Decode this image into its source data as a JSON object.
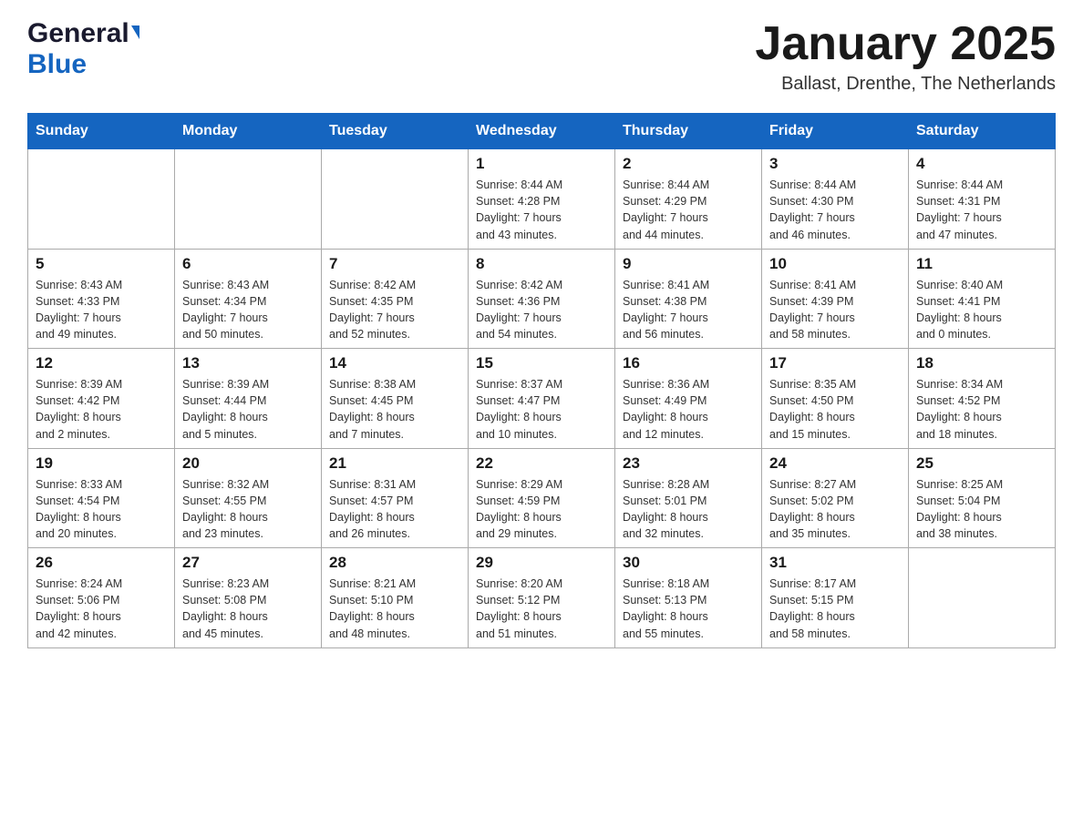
{
  "header": {
    "logo_general": "General",
    "logo_blue": "Blue",
    "month_title": "January 2025",
    "location": "Ballast, Drenthe, The Netherlands"
  },
  "days_of_week": [
    "Sunday",
    "Monday",
    "Tuesday",
    "Wednesday",
    "Thursday",
    "Friday",
    "Saturday"
  ],
  "weeks": [
    [
      {
        "day": "",
        "info": ""
      },
      {
        "day": "",
        "info": ""
      },
      {
        "day": "",
        "info": ""
      },
      {
        "day": "1",
        "info": "Sunrise: 8:44 AM\nSunset: 4:28 PM\nDaylight: 7 hours\nand 43 minutes."
      },
      {
        "day": "2",
        "info": "Sunrise: 8:44 AM\nSunset: 4:29 PM\nDaylight: 7 hours\nand 44 minutes."
      },
      {
        "day": "3",
        "info": "Sunrise: 8:44 AM\nSunset: 4:30 PM\nDaylight: 7 hours\nand 46 minutes."
      },
      {
        "day": "4",
        "info": "Sunrise: 8:44 AM\nSunset: 4:31 PM\nDaylight: 7 hours\nand 47 minutes."
      }
    ],
    [
      {
        "day": "5",
        "info": "Sunrise: 8:43 AM\nSunset: 4:33 PM\nDaylight: 7 hours\nand 49 minutes."
      },
      {
        "day": "6",
        "info": "Sunrise: 8:43 AM\nSunset: 4:34 PM\nDaylight: 7 hours\nand 50 minutes."
      },
      {
        "day": "7",
        "info": "Sunrise: 8:42 AM\nSunset: 4:35 PM\nDaylight: 7 hours\nand 52 minutes."
      },
      {
        "day": "8",
        "info": "Sunrise: 8:42 AM\nSunset: 4:36 PM\nDaylight: 7 hours\nand 54 minutes."
      },
      {
        "day": "9",
        "info": "Sunrise: 8:41 AM\nSunset: 4:38 PM\nDaylight: 7 hours\nand 56 minutes."
      },
      {
        "day": "10",
        "info": "Sunrise: 8:41 AM\nSunset: 4:39 PM\nDaylight: 7 hours\nand 58 minutes."
      },
      {
        "day": "11",
        "info": "Sunrise: 8:40 AM\nSunset: 4:41 PM\nDaylight: 8 hours\nand 0 minutes."
      }
    ],
    [
      {
        "day": "12",
        "info": "Sunrise: 8:39 AM\nSunset: 4:42 PM\nDaylight: 8 hours\nand 2 minutes."
      },
      {
        "day": "13",
        "info": "Sunrise: 8:39 AM\nSunset: 4:44 PM\nDaylight: 8 hours\nand 5 minutes."
      },
      {
        "day": "14",
        "info": "Sunrise: 8:38 AM\nSunset: 4:45 PM\nDaylight: 8 hours\nand 7 minutes."
      },
      {
        "day": "15",
        "info": "Sunrise: 8:37 AM\nSunset: 4:47 PM\nDaylight: 8 hours\nand 10 minutes."
      },
      {
        "day": "16",
        "info": "Sunrise: 8:36 AM\nSunset: 4:49 PM\nDaylight: 8 hours\nand 12 minutes."
      },
      {
        "day": "17",
        "info": "Sunrise: 8:35 AM\nSunset: 4:50 PM\nDaylight: 8 hours\nand 15 minutes."
      },
      {
        "day": "18",
        "info": "Sunrise: 8:34 AM\nSunset: 4:52 PM\nDaylight: 8 hours\nand 18 minutes."
      }
    ],
    [
      {
        "day": "19",
        "info": "Sunrise: 8:33 AM\nSunset: 4:54 PM\nDaylight: 8 hours\nand 20 minutes."
      },
      {
        "day": "20",
        "info": "Sunrise: 8:32 AM\nSunset: 4:55 PM\nDaylight: 8 hours\nand 23 minutes."
      },
      {
        "day": "21",
        "info": "Sunrise: 8:31 AM\nSunset: 4:57 PM\nDaylight: 8 hours\nand 26 minutes."
      },
      {
        "day": "22",
        "info": "Sunrise: 8:29 AM\nSunset: 4:59 PM\nDaylight: 8 hours\nand 29 minutes."
      },
      {
        "day": "23",
        "info": "Sunrise: 8:28 AM\nSunset: 5:01 PM\nDaylight: 8 hours\nand 32 minutes."
      },
      {
        "day": "24",
        "info": "Sunrise: 8:27 AM\nSunset: 5:02 PM\nDaylight: 8 hours\nand 35 minutes."
      },
      {
        "day": "25",
        "info": "Sunrise: 8:25 AM\nSunset: 5:04 PM\nDaylight: 8 hours\nand 38 minutes."
      }
    ],
    [
      {
        "day": "26",
        "info": "Sunrise: 8:24 AM\nSunset: 5:06 PM\nDaylight: 8 hours\nand 42 minutes."
      },
      {
        "day": "27",
        "info": "Sunrise: 8:23 AM\nSunset: 5:08 PM\nDaylight: 8 hours\nand 45 minutes."
      },
      {
        "day": "28",
        "info": "Sunrise: 8:21 AM\nSunset: 5:10 PM\nDaylight: 8 hours\nand 48 minutes."
      },
      {
        "day": "29",
        "info": "Sunrise: 8:20 AM\nSunset: 5:12 PM\nDaylight: 8 hours\nand 51 minutes."
      },
      {
        "day": "30",
        "info": "Sunrise: 8:18 AM\nSunset: 5:13 PM\nDaylight: 8 hours\nand 55 minutes."
      },
      {
        "day": "31",
        "info": "Sunrise: 8:17 AM\nSunset: 5:15 PM\nDaylight: 8 hours\nand 58 minutes."
      },
      {
        "day": "",
        "info": ""
      }
    ]
  ]
}
